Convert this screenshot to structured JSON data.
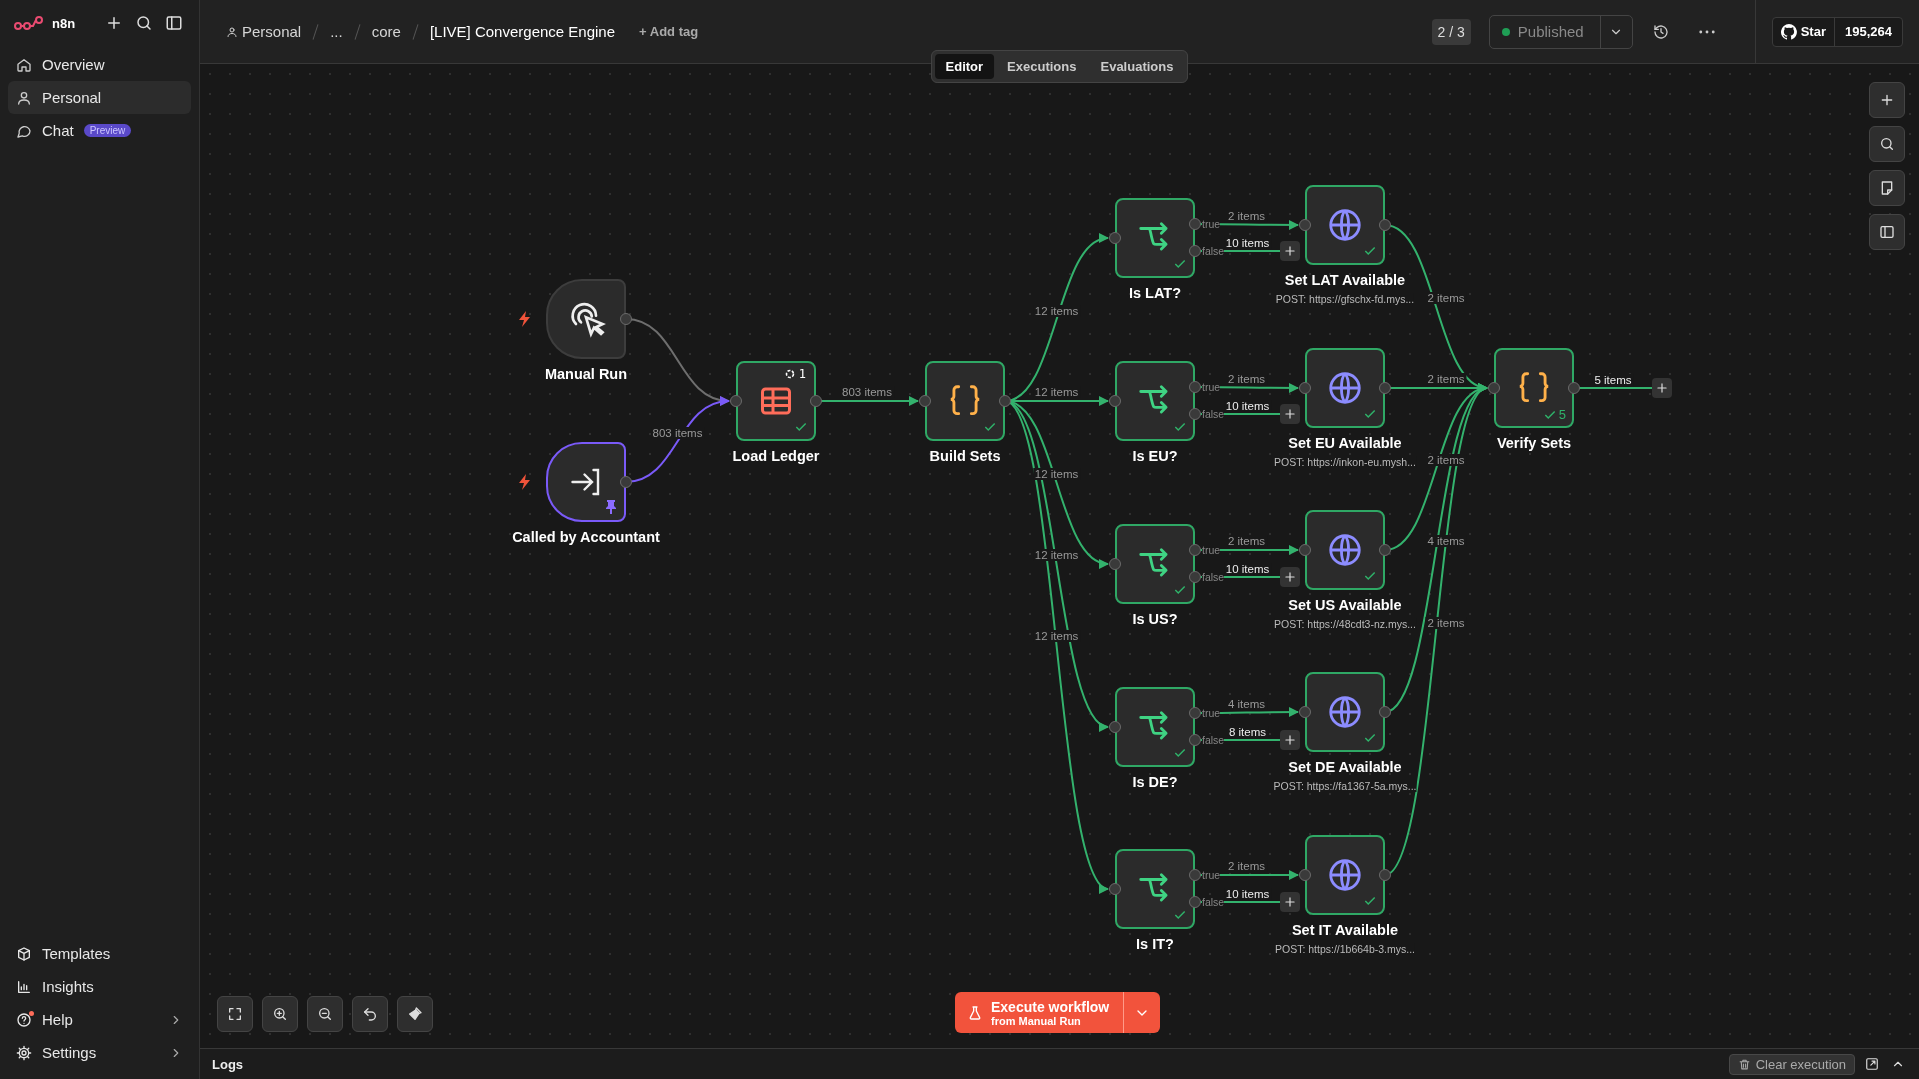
{
  "sidebar": {
    "logo": "n8n",
    "nav": [
      {
        "label": "Overview",
        "selected": false
      },
      {
        "label": "Personal",
        "selected": true
      },
      {
        "label": "Chat",
        "selected": false,
        "badge": "Preview"
      }
    ],
    "footer": [
      {
        "label": "Templates",
        "kind": "link",
        "notification": false
      },
      {
        "label": "Insights",
        "kind": "link",
        "notification": false
      },
      {
        "label": "Help",
        "kind": "menu",
        "notification": true
      },
      {
        "label": "Settings",
        "kind": "menu",
        "notification": false
      }
    ]
  },
  "header": {
    "breadcrumbs": [
      "Personal",
      "...",
      "core"
    ],
    "title": "[LIVE] Convergence Engine",
    "add_tag": "+ Add tag",
    "version": "2 / 3",
    "status": "Published",
    "github": {
      "label": "Star",
      "count": "195,264"
    }
  },
  "tabs": [
    {
      "label": "Editor",
      "selected": true
    },
    {
      "label": "Executions",
      "selected": false
    },
    {
      "label": "Evaluations",
      "selected": false
    }
  ],
  "nodes": [
    {
      "label": "Manual Run",
      "kind": "manual",
      "success": false,
      "pinned": false
    },
    {
      "label": "Called by Accountant",
      "kind": "subworkflow",
      "success": false,
      "pinned": true
    },
    {
      "label": "Load Ledger",
      "kind": "table",
      "success": true,
      "pinned": false,
      "runs": "1"
    },
    {
      "label": "Build Sets",
      "kind": "code",
      "success": true,
      "pinned": false
    },
    {
      "label": "Is LAT?",
      "kind": "if",
      "success": true,
      "pinned": false,
      "outputs": [
        "true",
        "false"
      ]
    },
    {
      "label": "Is EU?",
      "kind": "if",
      "success": true,
      "pinned": false,
      "outputs": [
        "true",
        "false"
      ]
    },
    {
      "label": "Is US?",
      "kind": "if",
      "success": true,
      "pinned": false,
      "outputs": [
        "true",
        "false"
      ]
    },
    {
      "label": "Is DE?",
      "kind": "if",
      "success": true,
      "pinned": false,
      "outputs": [
        "true",
        "false"
      ]
    },
    {
      "label": "Is IT?",
      "kind": "if",
      "success": true,
      "pinned": false,
      "outputs": [
        "true",
        "false"
      ]
    },
    {
      "label": "Set LAT Available",
      "kind": "http",
      "success": true,
      "pinned": false,
      "subtitle": "POST: https://gfschx-fd.mys..."
    },
    {
      "label": "Set EU Available",
      "kind": "http",
      "success": true,
      "pinned": false,
      "subtitle": "POST: https://inkon-eu.mysh..."
    },
    {
      "label": "Set US Available",
      "kind": "http",
      "success": true,
      "pinned": false,
      "subtitle": "POST: https://48cdt3-nz.mys..."
    },
    {
      "label": "Set DE Available",
      "kind": "http",
      "success": true,
      "pinned": false,
      "subtitle": "POST: https://fa1367-5a.mys..."
    },
    {
      "label": "Set IT Available",
      "kind": "http",
      "success": true,
      "pinned": false,
      "subtitle": "POST: https://1b664b-3.mys..."
    },
    {
      "label": "Verify Sets",
      "kind": "code",
      "success": true,
      "pinned": false,
      "count": "5"
    }
  ],
  "connections": [
    {
      "label": "803 items"
    },
    {
      "label": "803 items"
    },
    {
      "label": "12 items"
    },
    {
      "label": "12 items"
    },
    {
      "label": "12 items"
    },
    {
      "label": "12 items"
    },
    {
      "label": "12 items"
    },
    {
      "label": "2 items"
    },
    {
      "label": "10 items"
    },
    {
      "label": "2 items"
    },
    {
      "label": "10 items"
    },
    {
      "label": "2 items"
    },
    {
      "label": "10 items"
    },
    {
      "label": "4 items"
    },
    {
      "label": "8 items"
    },
    {
      "label": "2 items"
    },
    {
      "label": "10 items"
    },
    {
      "label": "2 items"
    },
    {
      "label": "2 items"
    },
    {
      "label": "2 items"
    },
    {
      "label": "4 items"
    },
    {
      "label": "2 items"
    },
    {
      "label": "5 items"
    }
  ],
  "execute": {
    "label": "Execute workflow",
    "sublabel": "from Manual Run"
  },
  "logs": {
    "title": "Logs",
    "clear": "Clear execution"
  }
}
